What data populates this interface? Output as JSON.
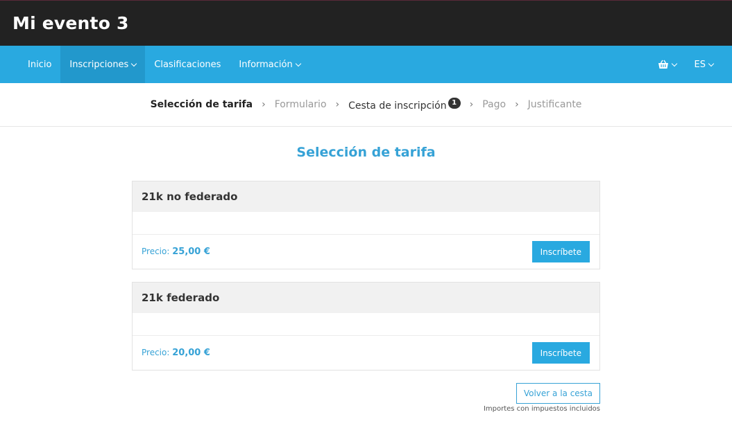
{
  "header": {
    "title": "Mi evento 3"
  },
  "nav": {
    "items": [
      {
        "label": "Inicio"
      },
      {
        "label": "Inscripciones"
      },
      {
        "label": "Clasificaciones"
      },
      {
        "label": "Información"
      }
    ],
    "language": "ES",
    "cart_icon": "shopping-basket-icon"
  },
  "steps": {
    "items": [
      {
        "label": "Selección de tarifa"
      },
      {
        "label": "Formulario"
      },
      {
        "label": "Cesta de inscripción",
        "badge": "1"
      },
      {
        "label": "Pago"
      },
      {
        "label": "Justificante"
      }
    ]
  },
  "main": {
    "title": "Selección de tarifa",
    "fares": [
      {
        "name": "21k no federado",
        "price_label": "Precio:",
        "price": "25,00 €",
        "button": "Inscríbete"
      },
      {
        "name": "21k federado",
        "price_label": "Precio:",
        "price": "20,00 €",
        "button": "Inscríbete"
      }
    ],
    "back_button": "Volver a la cesta",
    "tax_note": "Importes con impuestos incluidos"
  },
  "colors": {
    "header_bg": "#222222",
    "nav_bg": "#29a9e0",
    "nav_active": "#2298cc",
    "accent": "#36a2d6"
  }
}
